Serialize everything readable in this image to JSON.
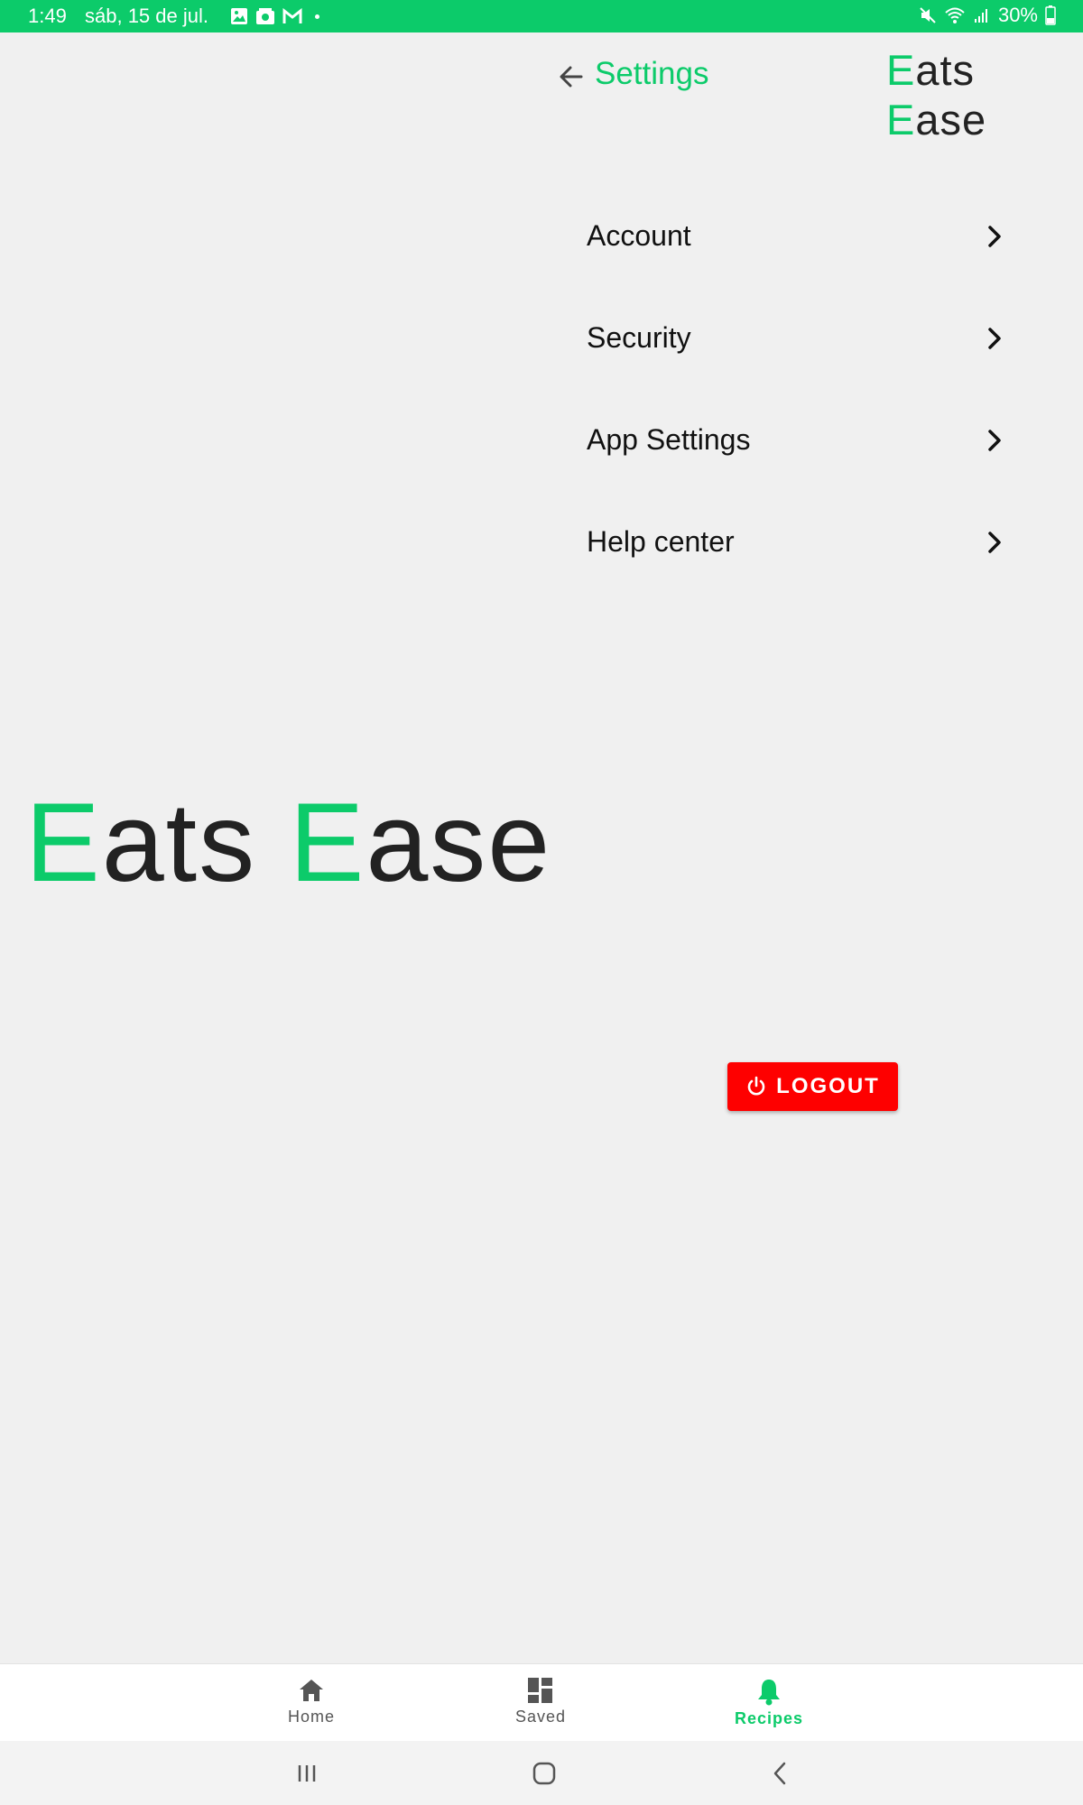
{
  "status_bar": {
    "time": "1:49",
    "date": "sáb, 15 de jul.",
    "battery": "30%",
    "icons": [
      "gallery-icon",
      "photo-icon",
      "gmail-icon",
      "notification-dot",
      "mute-icon",
      "wifi-icon",
      "signal-icon",
      "battery-icon"
    ],
    "background": "#0ccb6a"
  },
  "header": {
    "title": "Settings",
    "back_icon": "arrow-left-icon"
  },
  "brand": {
    "first_letter": "E",
    "first_rest": "ats",
    "second_letter": "E",
    "second_rest": "ase",
    "accent": "#0ccb6a"
  },
  "menu": {
    "items": [
      {
        "label": "Account"
      },
      {
        "label": "Security"
      },
      {
        "label": "App Settings"
      },
      {
        "label": "Help center"
      }
    ]
  },
  "logout": {
    "label": "LOGOUT",
    "color": "#fe0000",
    "icon": "power-icon"
  },
  "bottom_nav": {
    "items": [
      {
        "label": "Home",
        "icon": "home-icon"
      },
      {
        "label": "Saved",
        "icon": "dashboard-icon"
      },
      {
        "label": "Recipes",
        "icon": "bell-icon",
        "active": true
      }
    ]
  },
  "system_nav": {
    "items": [
      "recents-button",
      "home-button",
      "back-button"
    ]
  }
}
